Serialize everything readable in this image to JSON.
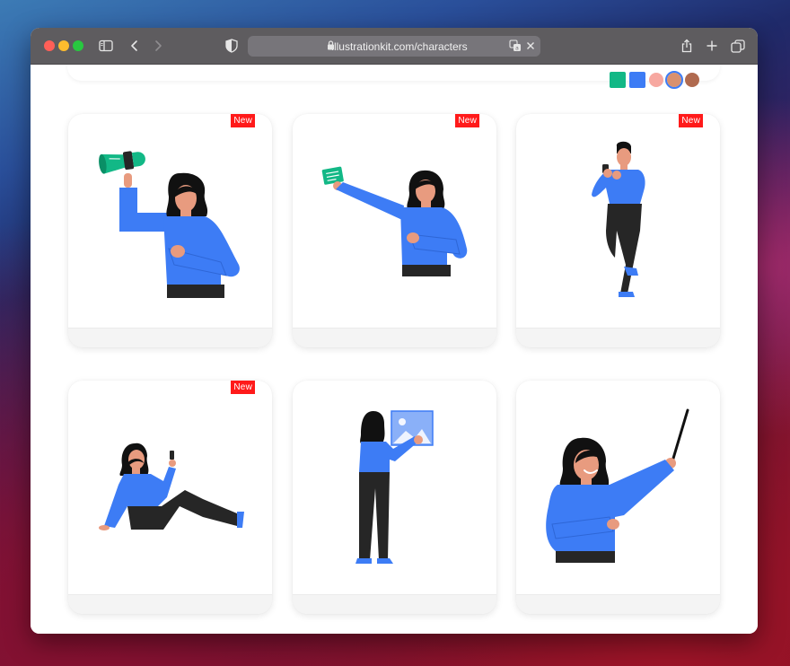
{
  "browser": {
    "url": "illustrationkit.com/characters"
  },
  "swatches": [
    {
      "color": "#12b886",
      "shape": "square",
      "selected": false
    },
    {
      "color": "#3d7cf5",
      "shape": "square",
      "selected": false
    },
    {
      "color": "#f7a8a0",
      "shape": "circle",
      "selected": false
    },
    {
      "color": "#d9916e",
      "shape": "circle",
      "selected": true
    },
    {
      "color": "#b06a4f",
      "shape": "circle",
      "selected": false
    }
  ],
  "cards": [
    {
      "badge": "New",
      "illustration": "woman-with-megaphone"
    },
    {
      "badge": "New",
      "illustration": "woman-holding-note"
    },
    {
      "badge": "New",
      "illustration": "man-using-phone"
    },
    {
      "badge": "New",
      "illustration": "woman-sitting-with-phone"
    },
    {
      "badge": "",
      "illustration": "woman-with-picture"
    },
    {
      "badge": "",
      "illustration": "woman-with-pointer"
    }
  ],
  "colors": {
    "shirt": "#3d7cf5",
    "pants": "#262626",
    "hair": "#111111",
    "skin": "#e89b7f",
    "accent": "#12b886",
    "badge": "#ff1a1a"
  }
}
